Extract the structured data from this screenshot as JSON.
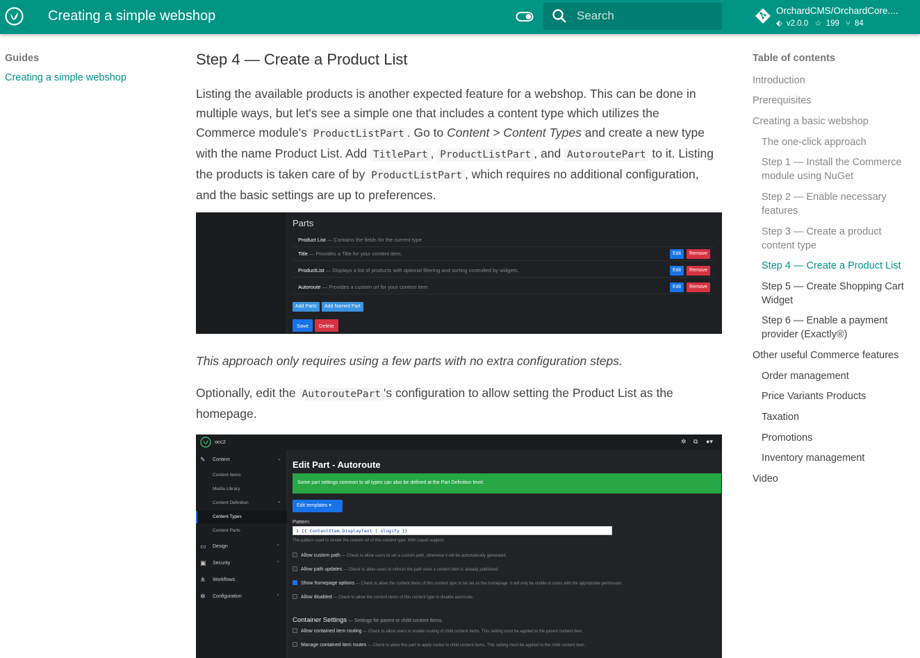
{
  "header": {
    "title": "Creating a simple webshop",
    "search_placeholder": "Search",
    "repo": {
      "name": "OrchardCMS/OrchardCore....",
      "version": "v2.0.0",
      "stars": "199",
      "forks": "84"
    }
  },
  "leftnav": {
    "title": "Guides",
    "link": "Creating a simple webshop"
  },
  "content": {
    "heading": "Step 4 — Create a Product List",
    "p1": {
      "t1": "Listing the available products is another expected feature for a webshop. This can be done in multiple ways, but let's see a simple one that includes a content type which utilizes the Commerce module's ",
      "c1": "ProductListPart",
      "t2": ". Go to ",
      "em1": "Content > Content Types",
      "t3": " and create a new type with the name Product List. Add ",
      "c2": "TitlePart",
      "t4": ", ",
      "c3": "ProductListPart",
      "t5": ", and ",
      "c4": "AutoroutePart",
      "t6": " to it. Listing the products is taken care of by ",
      "c5": "ProductListPart",
      "t7": ", which requires no additional configuration, and the basic settings are up to preferences."
    },
    "caption1": "This approach only requires using a few parts with no extra configuration steps.",
    "p3": {
      "t1": "Optionally, edit the ",
      "c1": "AutoroutePart",
      "t2": "'s configuration to allow setting the Product List as the homepage."
    }
  },
  "shot1": {
    "title": "Parts",
    "header_row": {
      "name": "Product List",
      "desc": " — Contains the fields for the current type"
    },
    "rows": [
      {
        "name": "Title",
        "desc": " — Provides a Title for your content item."
      },
      {
        "name": "ProductList",
        "desc": " — Displays a list of products with optional filtering and sorting controlled by widgets."
      },
      {
        "name": "Autoroute",
        "desc": " — Provides a custom url for your content item."
      }
    ],
    "edit": "Edit",
    "remove": "Remove",
    "add_parts": "Add Parts",
    "add_named_part": "Add Named Part",
    "save": "Save",
    "delete": "Delete"
  },
  "shot2": {
    "brand": "occ2",
    "sidebar": {
      "content": "Content",
      "content_items": "Content Items",
      "media_library": "Media Library",
      "content_definition": "Content Definition",
      "content_types": "Content Types",
      "content_parts": "Content Parts",
      "design": "Design",
      "security": "Security",
      "workflows": "Workflows",
      "configuration": "Configuration"
    },
    "title": "Edit Part - Autoroute",
    "alert": "Some part settings common to all types can also be defined at the Part Definition level.",
    "templates_btn": "Edit templates ▾",
    "pattern_label": "Pattern",
    "pattern_value": "1  {{ ContentItem.DisplayText | slugify }}",
    "pattern_hint": "The pattern used to render the custom url of this content type. With Liquid support.",
    "options": [
      {
        "label": "Allow custom path",
        "desc": " — Check to allow users to set a custom path, otherwise it will be automatically generated."
      },
      {
        "label": "Allow path updates",
        "desc": " — Check to allow users to refresh the path once a content item is already published."
      },
      {
        "label": "Show homepage options",
        "desc": " — Check to allow the content items of this content type to be set as the homepage. It will only be visible to users with the appropriate permission."
      },
      {
        "label": "Allow disabled",
        "desc": " — Check to allow the content items of this content type to disable autoroute."
      }
    ],
    "section_title": "Container Settings",
    "section_desc": " — Settings for parent or child content items.",
    "container_options": [
      {
        "label": "Allow contained item routing",
        "desc": " — Check to allow users to enable routing of child content items. This setting must be applied to the parent content item."
      },
      {
        "label": "Manage contained item routes",
        "desc": " — Check to allow this part to apply routes to child content items. This setting must be applied to the child content item."
      }
    ]
  },
  "toc": {
    "title": "Table of contents",
    "items": [
      "Introduction",
      "Prerequisites",
      "Creating a basic webshop",
      "The one-click approach",
      "Step 1 — Install the Commerce module using NuGet",
      "Step 2 — Enable necessary features",
      "Step 3 — Create a product content type",
      "Step 4 — Create a Product List",
      "Step 5 — Create Shopping Cart Widget",
      "Step 6 — Enable a payment provider (Exactly®)",
      "Other useful Commerce features",
      "Order management",
      "Price Variants Products",
      "Taxation",
      "Promotions",
      "Inventory management",
      "Video"
    ]
  },
  "colors": {
    "primary": "#009485",
    "active": "#009485"
  }
}
